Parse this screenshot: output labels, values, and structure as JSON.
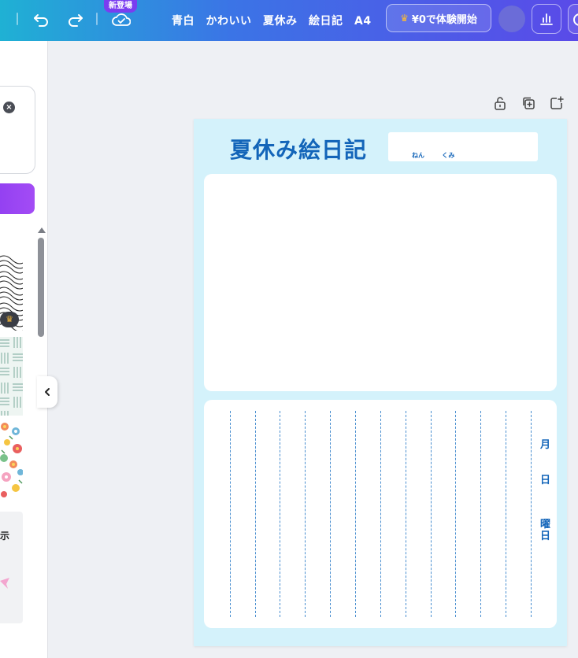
{
  "toolbar": {
    "new_badge": "新登場",
    "document_title": "青白　かわいい　夏休み　絵日記　A4",
    "trial_button": "¥0で体験開始",
    "trial_icon": "crown-icon"
  },
  "left_panel": {
    "clear_icon": "×",
    "gray_card_text": "示"
  },
  "diary": {
    "title": "夏休み絵日記",
    "grade_label": "ねん",
    "class_label": "くみ",
    "month_label": "月",
    "day_label": "日",
    "weekday_label": "曜日"
  },
  "colors": {
    "accent_blue": "#1365b9",
    "page_bg": "#d4f2fb",
    "premium_purple": "#8d3cf0"
  }
}
